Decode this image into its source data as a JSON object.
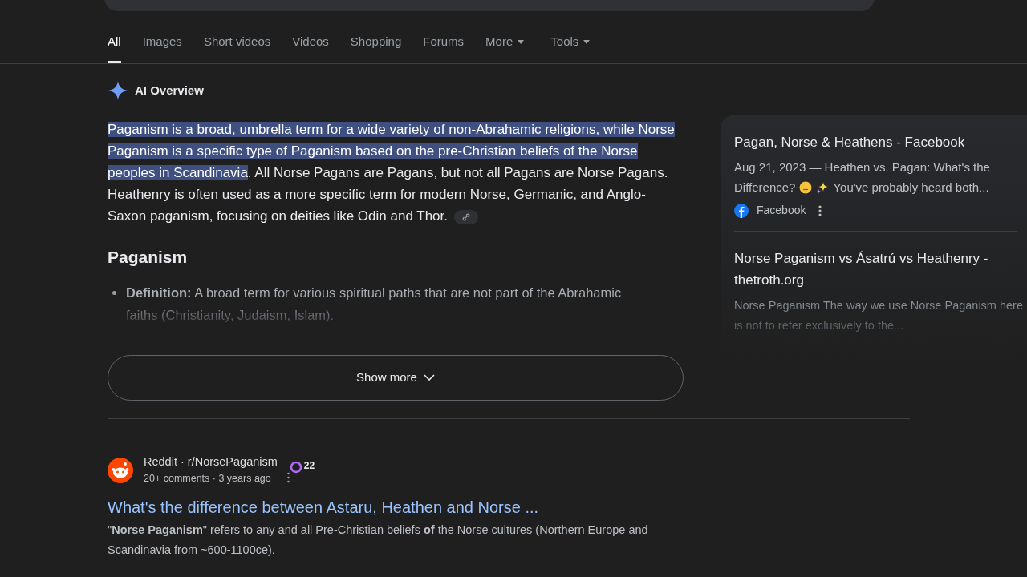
{
  "tabs": [
    {
      "label": "All",
      "selected": true
    },
    {
      "label": "Images",
      "selected": false
    },
    {
      "label": "Short videos",
      "selected": false
    },
    {
      "label": "Videos",
      "selected": false
    },
    {
      "label": "Shopping",
      "selected": false
    },
    {
      "label": "Forums",
      "selected": false
    },
    {
      "label": "More",
      "selected": false,
      "kind": "menu"
    }
  ],
  "tools": {
    "label": "Tools"
  },
  "ai_overview": {
    "title": "AI Overview",
    "summary": [
      {
        "text": "Paganism is a broad, umbrella term for a wide variety of non-Abrahamic religions, while Norse Paganism is a specific type of Paganism based on the pre-Christian beliefs of the Norse peoples in Scandinavia",
        "selected": true
      },
      {
        "text": ". All Norse Pagans are Pagans, but not all Pagans are Norse Pagans. Heathenry is often used as a more specific term for modern Norse, Germanic, and Anglo-Saxon paganism, focusing on deities like Odin and Thor.",
        "selected": false
      }
    ],
    "section_heading": "Paganism",
    "bullets": [
      {
        "term": "Definition:",
        "text": "A broad term for various spiritual paths that are not part of the Abrahamic faiths (Christianity, Judaism, Islam)."
      }
    ],
    "show_more": "Show more",
    "sources": [
      {
        "title": "Pagan, Norse & Heathens - Facebook",
        "snippet_before": "Aug 21, 2023 — Heathen vs. Pagan: What's the Difference?",
        "snippet_after": "You've probably heard both...",
        "site": "Facebook"
      },
      {
        "title": "Norse Paganism vs Ásatrú vs Heathenry - thetroth.org",
        "snippet": "Norse Paganism The way we use Norse Paganism here is not to refer exclusively to the..."
      }
    ]
  },
  "result": {
    "site": "Reddit · r/NorsePaganism",
    "meta": "20+ comments · 3 years ago",
    "count": "22",
    "title": "What's the difference between Astaru, Heathen and Norse ...",
    "snippet": "\"**Norse Paganism**\" refers to any and all Pre-Christian beliefs **of** the Norse cultures (Northern Europe and Scandinavia from ~600-1100ce)."
  }
}
